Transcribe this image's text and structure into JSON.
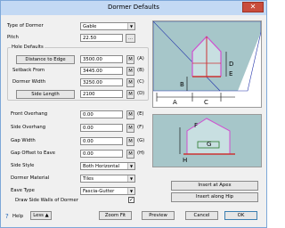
{
  "window": {
    "title": "Dormer Defaults",
    "close_glyph": "✕"
  },
  "fields": {
    "dormer_type": {
      "label": "Type of Dormer",
      "value": "Gable"
    },
    "pitch": {
      "label": "Pitch",
      "value": "22.50",
      "button": "..."
    },
    "hole_group_label": "Hole Defaults",
    "distance_to_edge": {
      "label": "Distance to Edge",
      "value": "3500.00",
      "key": "(A)"
    },
    "setback_from": {
      "label": "Setback From",
      "value": "3445.00",
      "key": "(B)"
    },
    "dormer_width": {
      "label": "Dormer Width",
      "value": "3250.00",
      "key": "(C)"
    },
    "side_length": {
      "label": "Side Length",
      "value": "2100",
      "key": "(D)"
    },
    "front_overhang": {
      "label": "Front Overhang",
      "value": "0.00",
      "key": "(E)"
    },
    "side_overhang": {
      "label": "Side Overhang",
      "value": "0.00",
      "key": "(F)"
    },
    "gap_width": {
      "label": "Gap Width",
      "value": "0.00",
      "key": "(G)"
    },
    "gap_offset_to_eave": {
      "label": "Gap Offset to Eave",
      "value": "0.00",
      "key": "(H)"
    },
    "side_style": {
      "label": "Side Style",
      "value": "Both Horizontal"
    },
    "dormer_material": {
      "label": "Dormer Material",
      "value": "Tiles"
    },
    "eave_type": {
      "label": "Eave Type",
      "value": "Fascia-Gutter"
    },
    "draw_side_walls": {
      "label": "Draw Side Walls of Dormer",
      "checked": "✓"
    },
    "m_label": "M"
  },
  "diagram_letters": {
    "a": "A",
    "b": "B",
    "c": "C",
    "d": "D",
    "e": "E",
    "f": "F",
    "g": "G",
    "h": "H"
  },
  "buttons": {
    "insert_at_apex": "Insert at Apex",
    "insert_along_hip": "Insert along Hip",
    "help": "Help",
    "less": "Less",
    "zoom_fit": "Zoom Fit",
    "preview": "Preview",
    "cancel": "Cancel",
    "ok": "OK"
  },
  "colors": {
    "roof": "#a6c6c9",
    "dormer": "#d04fd0",
    "wall": "#cc3333",
    "line": "#2233aa",
    "gap": "#2a7a2a"
  }
}
